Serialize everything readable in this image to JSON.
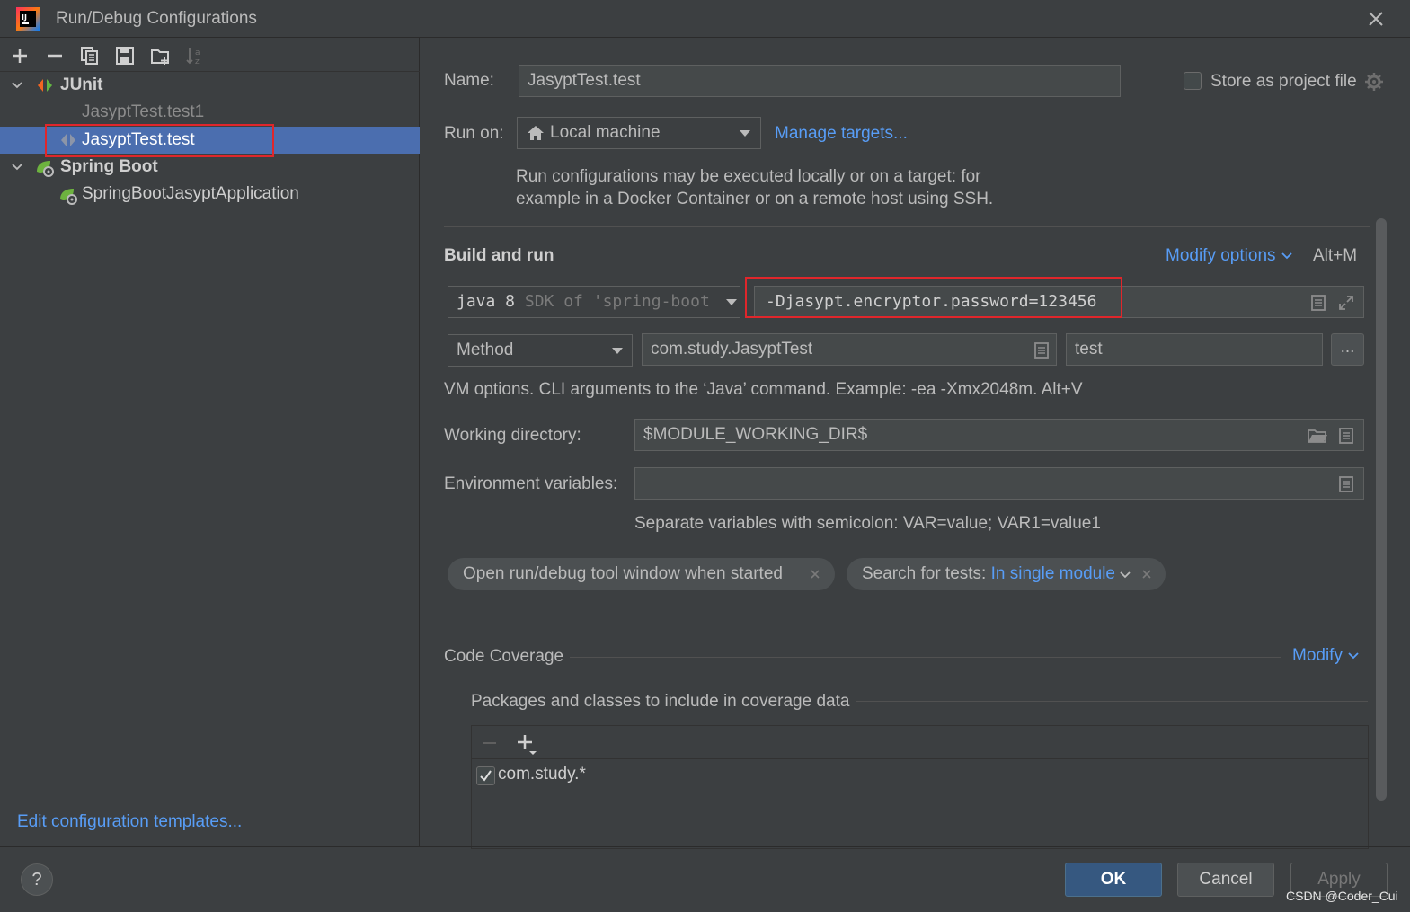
{
  "window": {
    "title": "Run/Debug Configurations"
  },
  "tree": {
    "junit_group": "JUnit",
    "junit_items": [
      "JasyptTest.test1",
      "JasyptTest.test"
    ],
    "spring_group": "Spring Boot",
    "spring_items": [
      "SpringBootJasyptApplication"
    ]
  },
  "left_footer": {
    "templates_link": "Edit configuration templates..."
  },
  "form": {
    "name_label": "Name:",
    "name_value": "JasyptTest.test",
    "store_label": "Store as project file",
    "store_checked": false,
    "run_on_label": "Run on:",
    "run_on_value": "Local machine",
    "manage_targets": "Manage targets...",
    "run_hint_line1": "Run configurations may be executed locally or on a target: for",
    "run_hint_line2": "example in a Docker Container or on a remote host using SSH."
  },
  "build": {
    "section_title": "Build and run",
    "modify_options": "Modify options",
    "shortcut": "Alt+M",
    "jre_strong": "java 8",
    "jre_muted": "SDK of 'spring-boot",
    "vm_options": "-Djasypt.encryptor.password=123456",
    "kind": "Method",
    "class_value": "com.study.JasyptTest",
    "method_value": "test",
    "browse_label": "...",
    "vm_hint": "VM options. CLI arguments to the ‘Java’ command. Example: -ea -Xmx2048m. Alt+V",
    "workdir_label": "Working directory:",
    "workdir_value": "$MODULE_WORKING_DIR$",
    "env_label": "Environment variables:",
    "env_value": "",
    "env_hint": "Separate variables with semicolon: VAR=value; VAR1=value1",
    "chip_open_tool": "Open run/debug tool window when started",
    "chip_search_prefix": "Search for tests:",
    "chip_search_value": "In single module"
  },
  "coverage": {
    "section_title": "Code Coverage",
    "modify": "Modify",
    "packages_title": "Packages and classes to include in coverage data",
    "entries": [
      {
        "label": "com.study.*",
        "checked": true
      }
    ]
  },
  "footer": {
    "help": "?",
    "ok": "OK",
    "cancel": "Cancel",
    "apply": "Apply",
    "watermark": "CSDN @Coder_Cui"
  },
  "colors": {
    "background": "#3c3f41",
    "selection": "#4b6eaf",
    "link": "#589df6",
    "highlight_box": "#e0262b"
  }
}
